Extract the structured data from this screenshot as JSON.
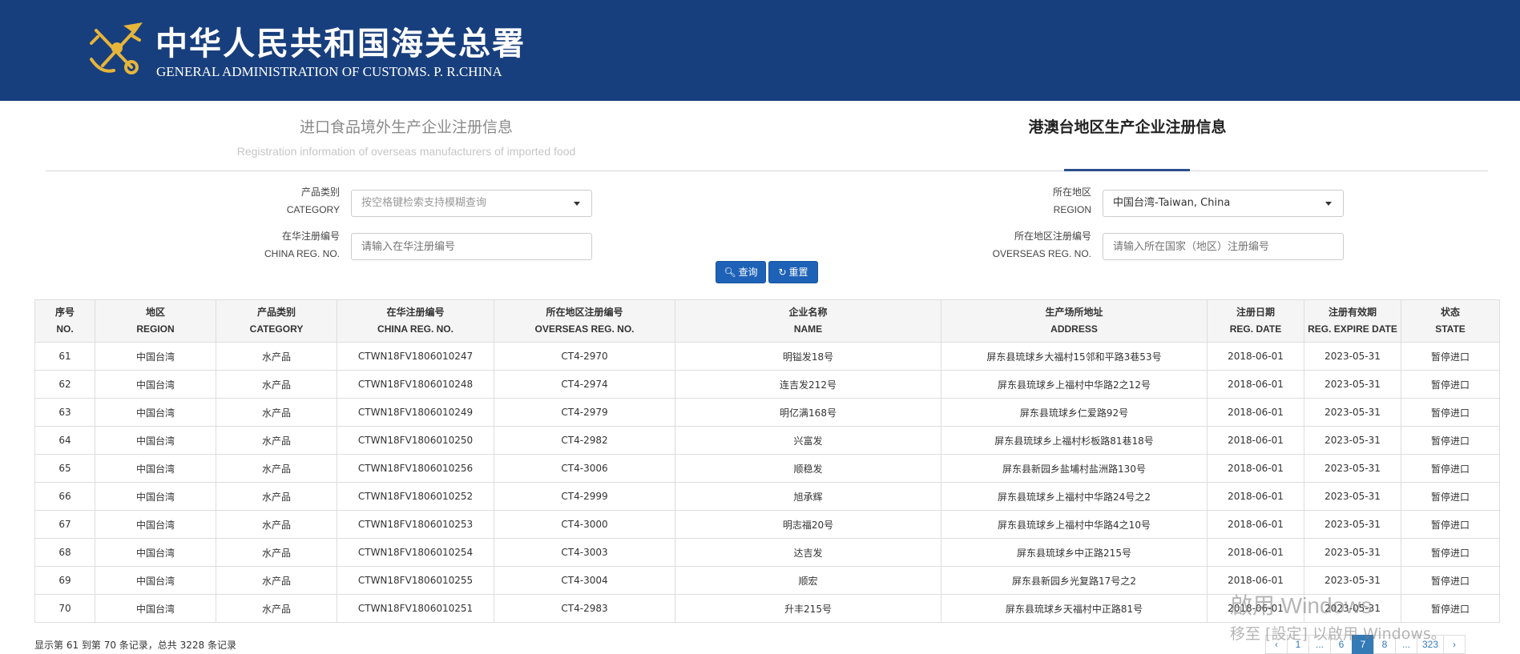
{
  "header": {
    "title_cn": "中华人民共和国海关总署",
    "title_en": "GENERAL ADMINISTRATION OF CUSTOMS. P. R.CHINA"
  },
  "tabs": {
    "left": {
      "cn": "进口食品境外生产企业注册信息",
      "en": "Registration information of overseas manufacturers of imported food"
    },
    "right": {
      "cn": "港澳台地区生产企业注册信息"
    }
  },
  "form": {
    "category": {
      "label_cn": "产品类别",
      "label_en": "CATEGORY",
      "placeholder": "按空格键检索支持模糊查询"
    },
    "region": {
      "label_cn": "所在地区",
      "label_en": "REGION",
      "value": "中国台湾-Taiwan, China"
    },
    "china_reg": {
      "label_cn": "在华注册编号",
      "label_en": "CHINA REG. NO.",
      "placeholder": "请输入在华注册编号"
    },
    "overseas_reg": {
      "label_cn": "所在地区注册编号",
      "label_en": "OVERSEAS REG. NO.",
      "placeholder": "请输入所在国家（地区）注册编号"
    },
    "search_label": "查询",
    "reset_label": "重置"
  },
  "table": {
    "headers": [
      {
        "cn": "序号",
        "en": "NO."
      },
      {
        "cn": "地区",
        "en": "REGION"
      },
      {
        "cn": "产品类别",
        "en": "CATEGORY"
      },
      {
        "cn": "在华注册编号",
        "en": "CHINA REG. NO."
      },
      {
        "cn": "所在地区注册编号",
        "en": "OVERSEAS REG. NO."
      },
      {
        "cn": "企业名称",
        "en": "NAME"
      },
      {
        "cn": "生产场所地址",
        "en": "ADDRESS"
      },
      {
        "cn": "注册日期",
        "en": "REG. DATE"
      },
      {
        "cn": "注册有效期",
        "en": "REG. EXPIRE DATE"
      },
      {
        "cn": "状态",
        "en": "STATE"
      }
    ],
    "rows": [
      [
        "61",
        "中国台湾",
        "水产品",
        "CTWN18FV1806010247",
        "CT4-2970",
        "明镒发18号",
        "屏东县琉球乡大福村15邻和平路3巷53号",
        "2018-06-01",
        "2023-05-31",
        "暂停进口"
      ],
      [
        "62",
        "中国台湾",
        "水产品",
        "CTWN18FV1806010248",
        "CT4-2974",
        "连吉发212号",
        "屏东县琉球乡上福村中华路2之12号",
        "2018-06-01",
        "2023-05-31",
        "暂停进口"
      ],
      [
        "63",
        "中国台湾",
        "水产品",
        "CTWN18FV1806010249",
        "CT4-2979",
        "明亿满168号",
        "屏东县琉球乡仁爱路92号",
        "2018-06-01",
        "2023-05-31",
        "暂停进口"
      ],
      [
        "64",
        "中国台湾",
        "水产品",
        "CTWN18FV1806010250",
        "CT4-2982",
        "兴富发",
        "屏东县琉球乡上福村杉板路81巷18号",
        "2018-06-01",
        "2023-05-31",
        "暂停进口"
      ],
      [
        "65",
        "中国台湾",
        "水产品",
        "CTWN18FV1806010256",
        "CT4-3006",
        "顺稳发",
        "屏东县新园乡盐埔村盐洲路130号",
        "2018-06-01",
        "2023-05-31",
        "暂停进口"
      ],
      [
        "66",
        "中国台湾",
        "水产品",
        "CTWN18FV1806010252",
        "CT4-2999",
        "旭承辉",
        "屏东县琉球乡上福村中华路24号之2",
        "2018-06-01",
        "2023-05-31",
        "暂停进口"
      ],
      [
        "67",
        "中国台湾",
        "水产品",
        "CTWN18FV1806010253",
        "CT4-3000",
        "明志福20号",
        "屏东县琉球乡上福村中华路4之10号",
        "2018-06-01",
        "2023-05-31",
        "暂停进口"
      ],
      [
        "68",
        "中国台湾",
        "水产品",
        "CTWN18FV1806010254",
        "CT4-3003",
        "达吉发",
        "屏东县琉球乡中正路215号",
        "2018-06-01",
        "2023-05-31",
        "暂停进口"
      ],
      [
        "69",
        "中国台湾",
        "水产品",
        "CTWN18FV1806010255",
        "CT4-3004",
        "顺宏",
        "屏东县新园乡光复路17号之2",
        "2018-06-01",
        "2023-05-31",
        "暂停进口"
      ],
      [
        "70",
        "中国台湾",
        "水产品",
        "CTWN18FV1806010251",
        "CT4-2983",
        "升丰215号",
        "屏东县琉球乡天福村中正路81号",
        "2018-06-01",
        "2023-05-31",
        "暂停进口"
      ]
    ]
  },
  "footer": {
    "info": "显示第 61 到第 70 条记录，总共 3228 条记录"
  },
  "pagination": [
    "‹",
    "1",
    "...",
    "6",
    "7",
    "8",
    "...",
    "323",
    "›"
  ],
  "pagination_active": "7",
  "watermark": {
    "line1": "啟用 Windows",
    "line2": "移至 [設定] 以啟用 Windows。"
  }
}
